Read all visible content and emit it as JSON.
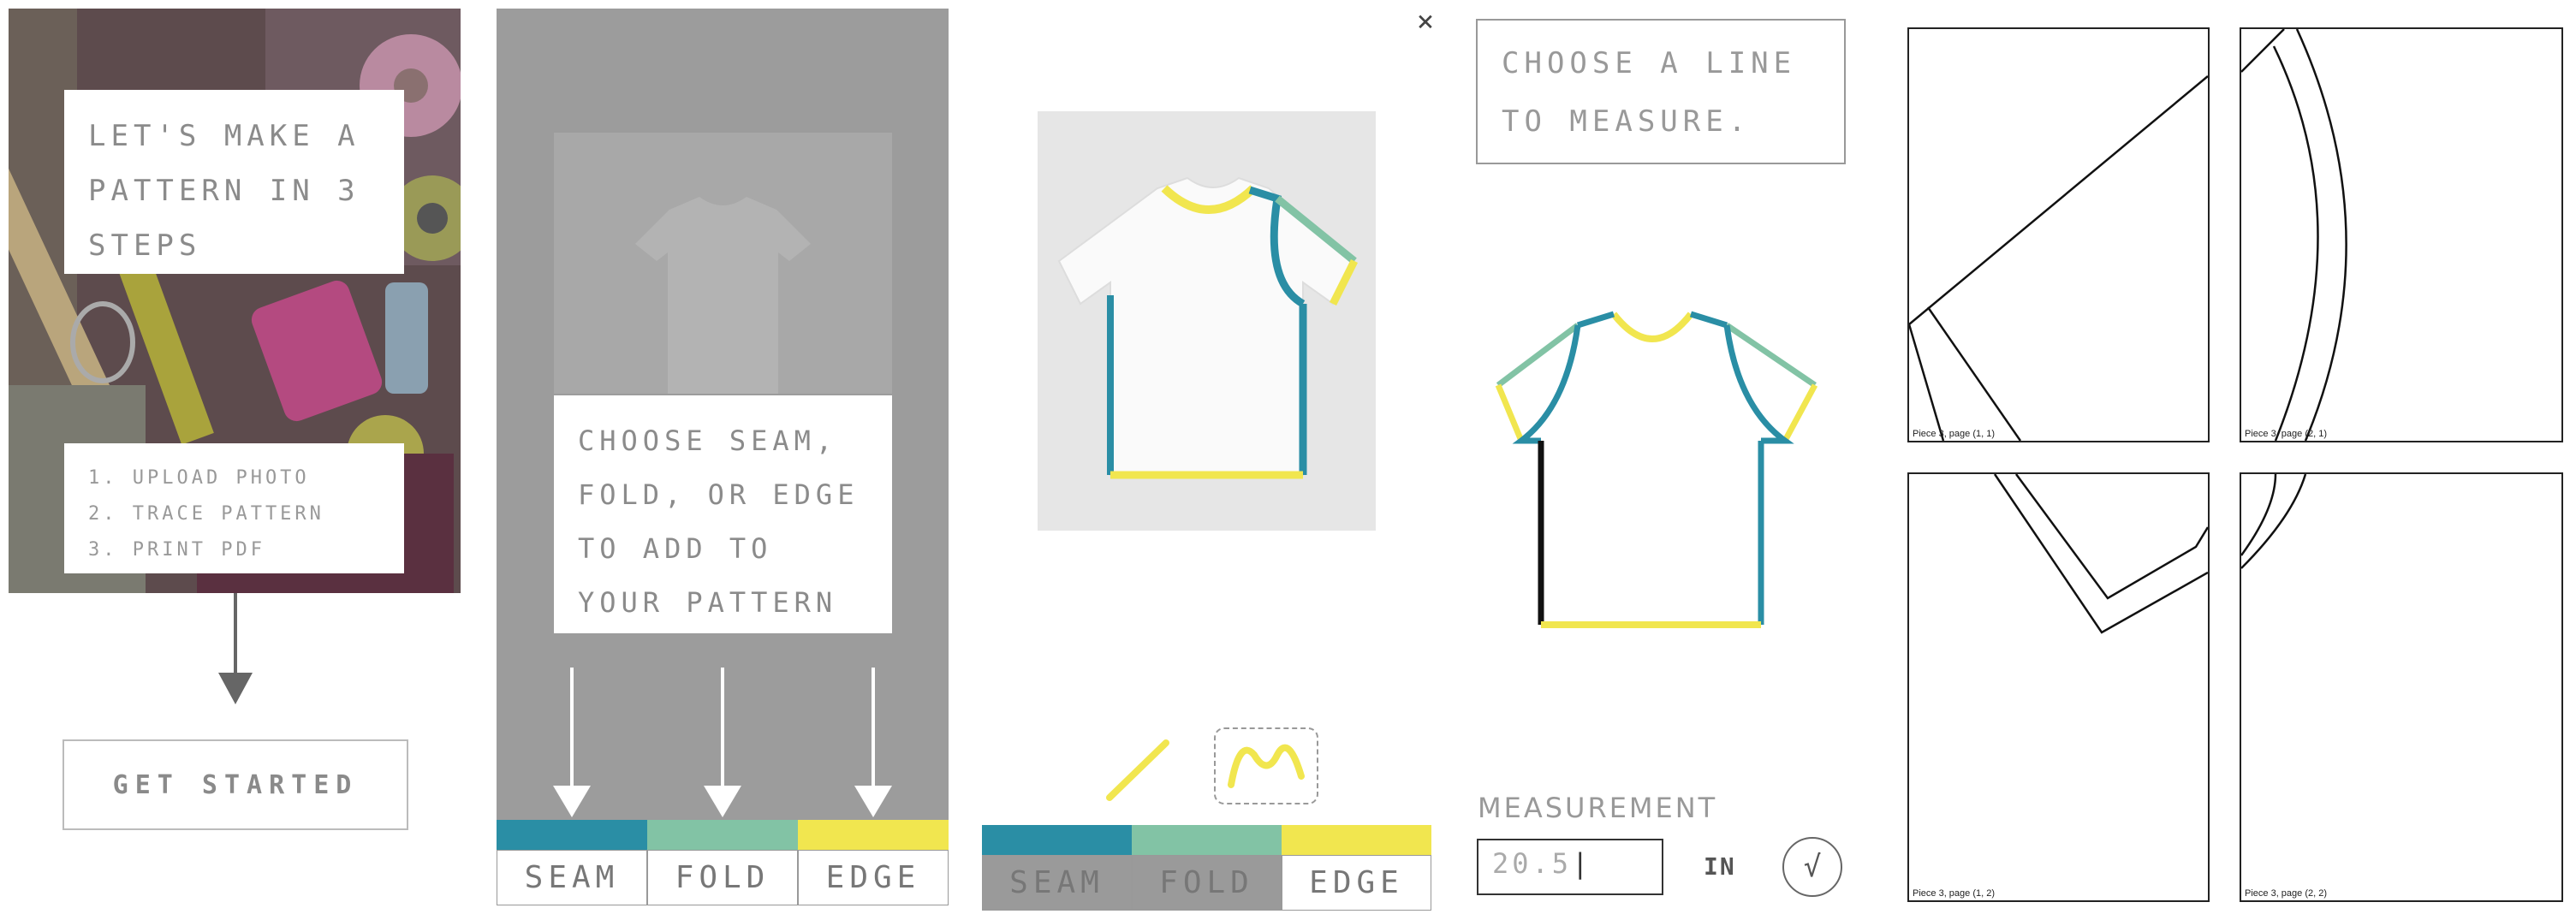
{
  "panel1": {
    "title": "LET'S MAKE A PATTERN IN 3 STEPS",
    "steps": [
      "1. UPLOAD PHOTO",
      "2. TRACE PATTERN",
      "3. PRINT PDF"
    ],
    "get_started": "GET STARTED"
  },
  "panel2": {
    "instruction": "CHOOSE SEAM, FOLD, OR EDGE TO ADD TO YOUR PATTERN",
    "tabs": [
      {
        "label": "SEAM",
        "color": "#2a8ea5"
      },
      {
        "label": "FOLD",
        "color": "#82c3a5"
      },
      {
        "label": "EDGE",
        "color": "#f1e64f"
      }
    ]
  },
  "panel3": {
    "close": "×",
    "tools": [
      "straight-line-icon",
      "curve-line-icon"
    ],
    "tabs": [
      {
        "label": "SEAM",
        "color": "#2a8ea5"
      },
      {
        "label": "FOLD",
        "color": "#82c3a5"
      },
      {
        "label": "EDGE",
        "color": "#f1e64f"
      }
    ]
  },
  "panel4": {
    "instruction": "CHOOSE A LINE TO MEASURE.",
    "measurement_label": "MEASUREMENT",
    "measurement_value": "20.5",
    "unit": "IN",
    "confirm": "√"
  },
  "panel5": {
    "pages": [
      "Piece 3, page (1, 1)",
      "Piece 3, page (2, 1)",
      "Piece 3, page (1, 2)",
      "Piece 3, page (2, 2)"
    ]
  },
  "colors": {
    "seam": "#2a8ea5",
    "fold": "#82c3a5",
    "edge": "#f1e64f"
  }
}
